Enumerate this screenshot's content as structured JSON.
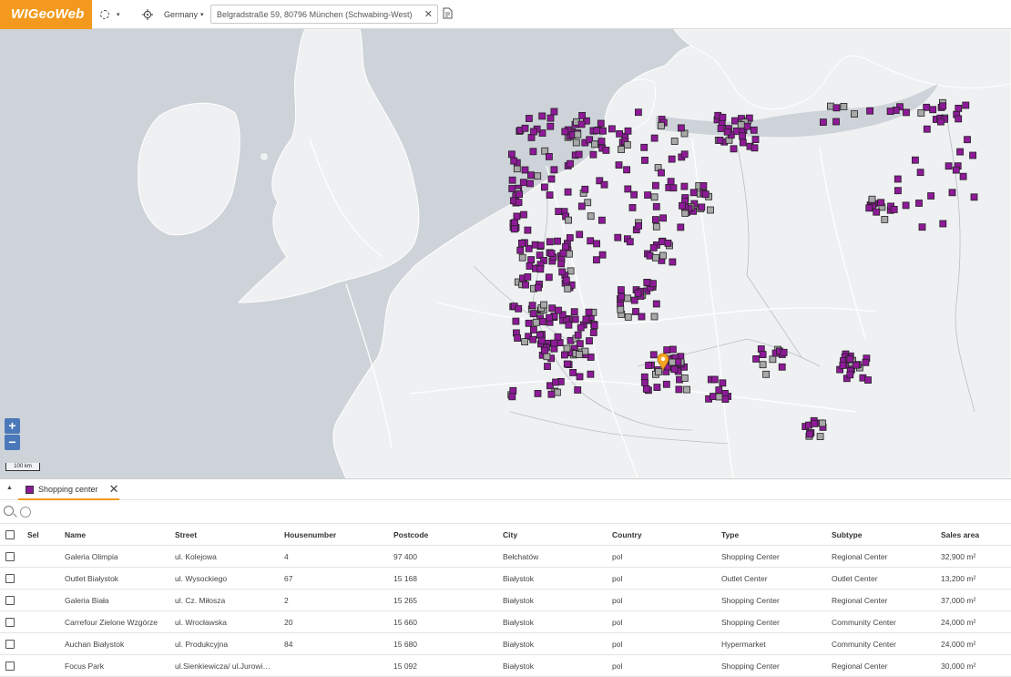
{
  "app": {
    "logo": "WIGeoWeb"
  },
  "toolbar": {
    "lasso_caret": "▾",
    "country": "Germany",
    "country_caret": "▾",
    "search": {
      "value": "Belgradstraße 59, 80796 München (Schwabing-West)",
      "clear": "✕"
    }
  },
  "map": {
    "zoom_in": "+",
    "zoom_out": "−",
    "scale": "100 km",
    "colors": {
      "water": "#cdd3d8",
      "land": "#eef0f2",
      "marker": "#8e1a98",
      "marker_gray": "#a8a8a8",
      "pin": "#f5a623"
    },
    "location_pin": {
      "lon": 11.57,
      "lat": 48.16,
      "label": "Belgradstraße 59, 80796 München (Schwabing-West)"
    }
  },
  "panel": {
    "collapse": "▲",
    "layer_tab": {
      "label": "Shopping center",
      "close": "✕",
      "color": "#8e1a98"
    },
    "table": {
      "columns": [
        "Sel",
        "Name",
        "Street",
        "Housenumber",
        "Postcode",
        "City",
        "Country",
        "Type",
        "Subtype",
        "Sales area"
      ],
      "rows": [
        [
          "Galeria Olimpia",
          "ul. Kolejowa",
          "4",
          "97 400",
          "Bełchatów",
          "pol",
          "Shopping Center",
          "Regional Center",
          "32,900 m²"
        ],
        [
          "Outlet Białystok",
          "ul. Wysockiego",
          "67",
          "15 168",
          "Białystok",
          "pol",
          "Outlet Center",
          "Outlet Center",
          "13,200 m²"
        ],
        [
          "Galeria Biała",
          "ul. Cz. Miłosza",
          "2",
          "15 265",
          "Białystok",
          "pol",
          "Shopping Center",
          "Regional Center",
          "37,000 m²"
        ],
        [
          "Carrefour Zielone Wzgórze",
          "ul. Wrocławska",
          "20",
          "15 660",
          "Białystok",
          "pol",
          "Shopping Center",
          "Community Center",
          "24,000 m²"
        ],
        [
          "Auchan Białystok",
          "ul. Produkcyjna",
          "84",
          "15 680",
          "Białystok",
          "pol",
          "Hypermarket",
          "Community Center",
          "24,000 m²"
        ],
        [
          "Focus Park",
          "ul.Sienkiewicza/ ul.Jurowi…",
          "",
          "15 092",
          "Białystok",
          "pol",
          "Shopping Center",
          "Regional Center",
          "30,000 m²"
        ]
      ]
    }
  }
}
